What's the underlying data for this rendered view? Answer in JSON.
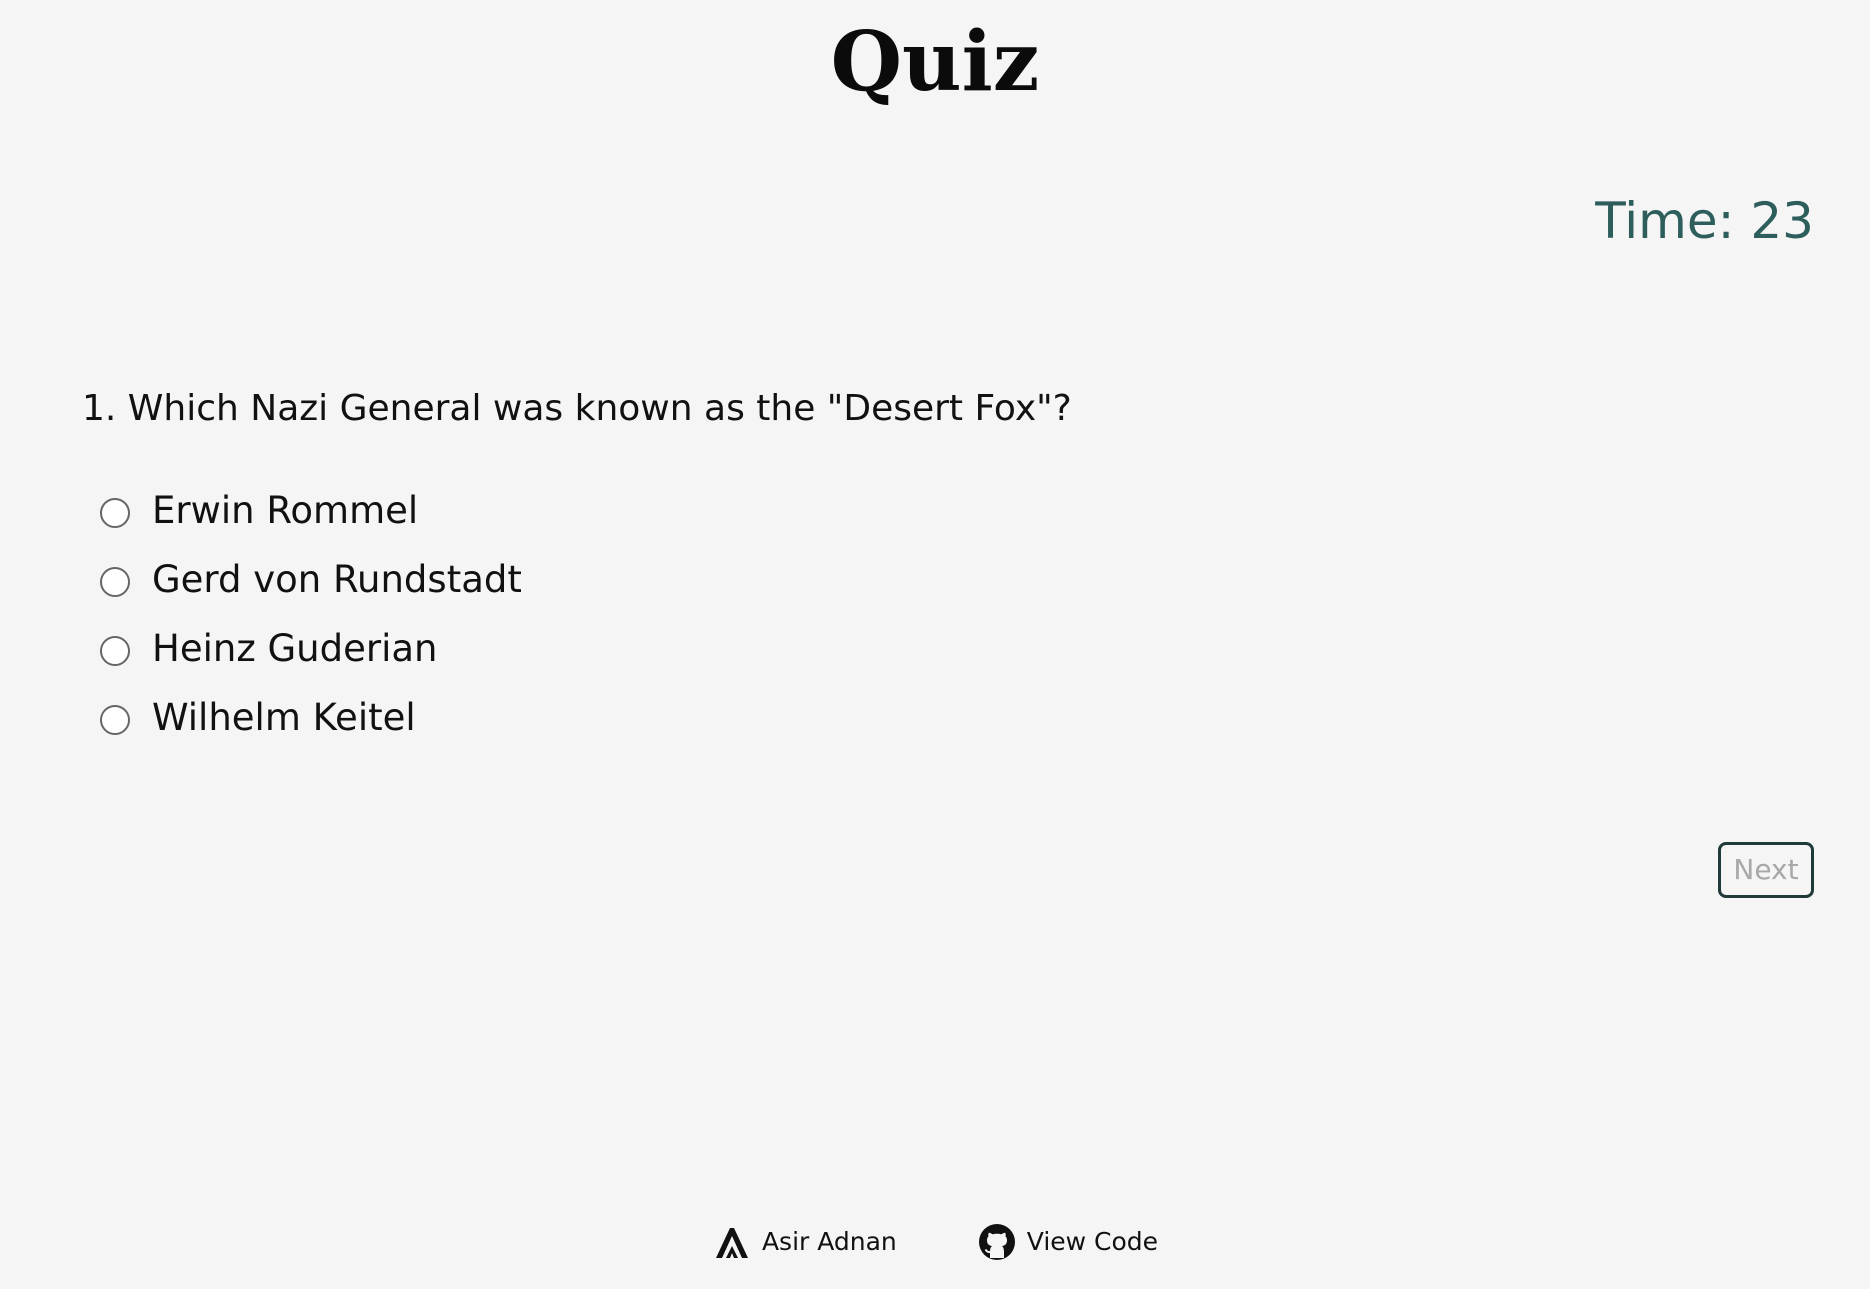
{
  "page": {
    "title": "Quiz"
  },
  "timer": {
    "text": "Time: 23",
    "color": "#2e5e5c"
  },
  "question": {
    "text": "1. Which Nazi General was known as the \"Desert Fox\"?",
    "options": [
      {
        "label": "Erwin Rommel",
        "selected": false
      },
      {
        "label": "Gerd von Rundstadt",
        "selected": false
      },
      {
        "label": "Heinz Guderian",
        "selected": false
      },
      {
        "label": "Wilhelm Keitel",
        "selected": false
      }
    ]
  },
  "controls": {
    "next_label": "Next",
    "next_enabled": false
  },
  "footer": {
    "author_label": "Asir Adnan",
    "author_icon": "logo-a-icon",
    "code_label": "View Code",
    "code_icon": "github-icon"
  },
  "colors": {
    "background": "#f5f5f5",
    "accent": "#2e5e5c",
    "disabled_text": "#a8a8a8"
  }
}
